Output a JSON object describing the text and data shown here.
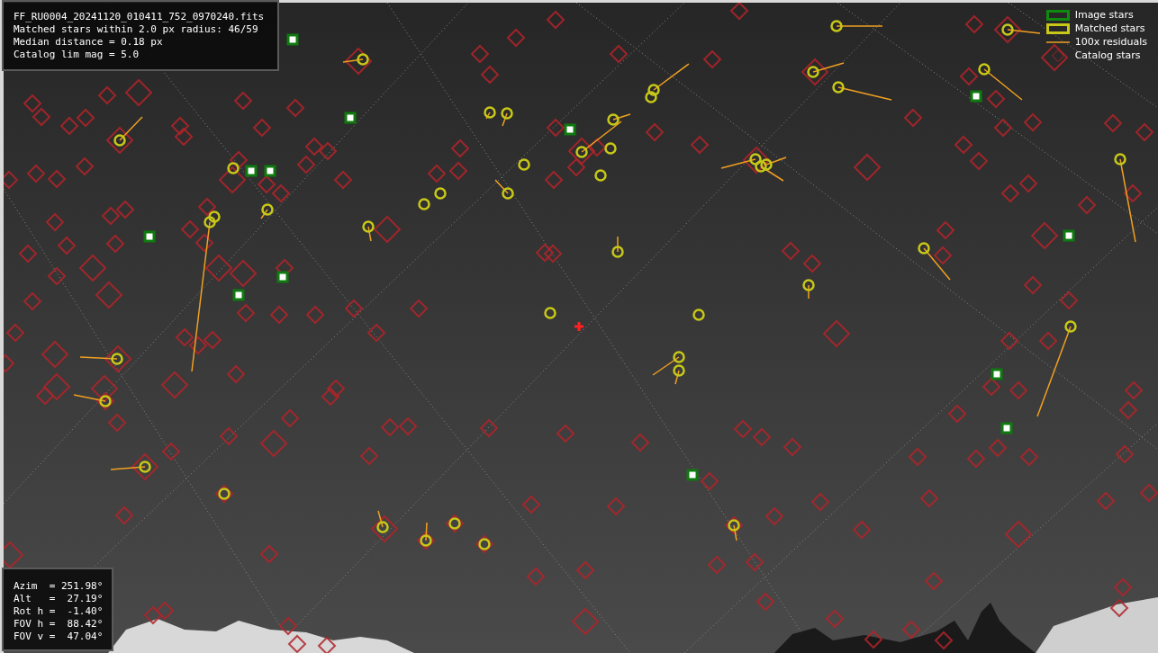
{
  "info_box": {
    "lines": [
      "FF_RU0004_20241120_010411_752_0970240.fits",
      "Matched stars within 2.0 px radius: 46/59",
      "Median distance = 0.18 px",
      "Catalog lim mag = 5.0"
    ]
  },
  "legend": {
    "items": [
      {
        "kind": "image",
        "label": "Image stars"
      },
      {
        "kind": "matched",
        "label": "Matched stars"
      },
      {
        "kind": "residual",
        "label": "100x residuals"
      },
      {
        "kind": "catalog",
        "label": "Catalog stars"
      }
    ]
  },
  "pointing_box": {
    "lines": [
      "Azim  = 251.98°",
      "Alt   =  27.19°",
      "Rot h =  -1.40°",
      "FOV h =  88.42°",
      "FOV v =  47.04°"
    ]
  }
}
